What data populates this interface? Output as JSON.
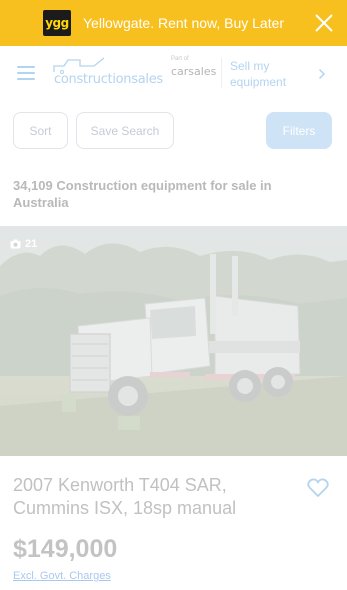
{
  "promo": {
    "logo_text": "ygg",
    "text": "Yellowgate. Rent now, Buy Later"
  },
  "header": {
    "brand": "constructionsales",
    "part_of_label": "Part of",
    "partner": "carsales",
    "sell_link": "Sell my equipment"
  },
  "toolbar": {
    "sort_label": "Sort",
    "save_search_label": "Save Search",
    "filters_label": "Filters"
  },
  "results": {
    "count_text": "34,109 Construction equipment for sale in Australia"
  },
  "listing": {
    "photo_count": "21",
    "title": "2007 Kenworth T404 SAR, Cummins ISX, 18sp manual",
    "price": "$149,000",
    "price_note": "Excl. Govt. Charges"
  },
  "colors": {
    "promo_bg": "#f8c01e",
    "accent": "#b3d4f0",
    "filter_button": "#cfe3f6"
  },
  "icons": [
    "close-icon",
    "hamburger-icon",
    "chevron-right-icon",
    "camera-icon",
    "heart-icon",
    "truck-logo-icon"
  ]
}
